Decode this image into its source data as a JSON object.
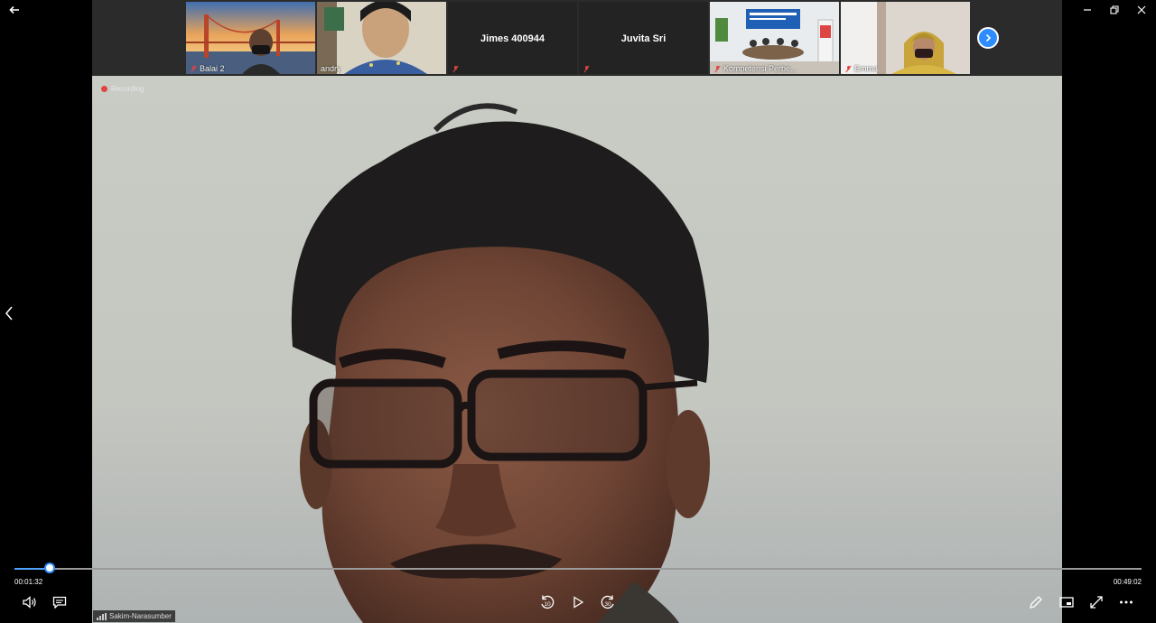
{
  "window": {
    "back_icon": "arrow-left-icon",
    "controls": [
      "minimize-icon",
      "restore-icon",
      "close-icon"
    ]
  },
  "participants": [
    {
      "name": "Balai 2",
      "muted": true,
      "video": true
    },
    {
      "name": "andry",
      "muted": false,
      "video": true
    },
    {
      "name": "Jimes 400944",
      "muted": true,
      "video": false
    },
    {
      "name": "Juvita Sri",
      "muted": true,
      "video": false
    },
    {
      "name": "Kompetensi Perbe...",
      "muted": true,
      "video": true
    },
    {
      "name": "Emma",
      "muted": true,
      "video": true
    }
  ],
  "recording_label": "Recording",
  "active_speaker": "Sakim-Narasumber",
  "player": {
    "current_time": "00:01:32",
    "total_time": "00:49:02",
    "progress": 0.031,
    "skip_back": "10",
    "skip_forward": "30"
  },
  "colors": {
    "accent": "#2d8cff",
    "recording": "#e04343",
    "muted": "#e04343"
  }
}
